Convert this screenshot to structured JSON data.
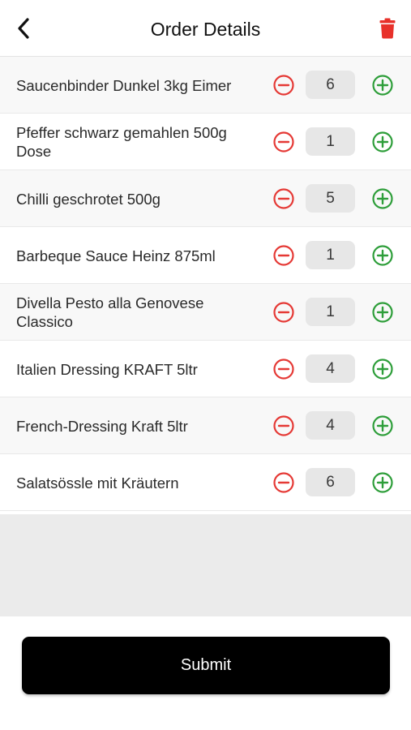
{
  "header": {
    "title": "Order Details",
    "back_icon": "chevron-left-icon",
    "delete_icon": "trash-icon",
    "delete_color": "#e8312a"
  },
  "items": [
    {
      "name": "Saucenbinder Dunkel 3kg Eimer",
      "qty": "6"
    },
    {
      "name": "Pfeffer schwarz gemahlen 500g Dose",
      "qty": "1"
    },
    {
      "name": "Chilli geschrotet 500g",
      "qty": "5"
    },
    {
      "name": "Barbeque Sauce Heinz 875ml",
      "qty": "1"
    },
    {
      "name": "Divella  Pesto alla Genovese Classico",
      "qty": "1"
    },
    {
      "name": "Italien  Dressing KRAFT 5ltr",
      "qty": "4"
    },
    {
      "name": "French-Dressing Kraft 5ltr",
      "qty": "4"
    },
    {
      "name": "Salatsössle mit Kräutern",
      "qty": "6"
    }
  ],
  "controls": {
    "minus_icon": "minus-circle-icon",
    "plus_icon": "plus-circle-icon",
    "minus_color": "#e53935",
    "plus_color": "#2e9e3a"
  },
  "footer": {
    "submit_label": "Submit"
  }
}
